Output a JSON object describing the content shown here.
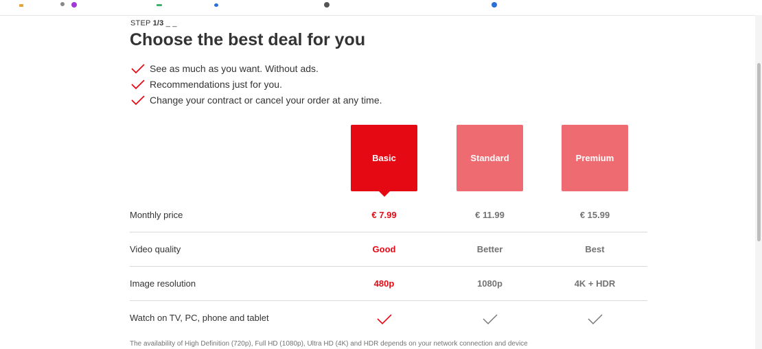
{
  "step": {
    "prefix": "STEP ",
    "current": "1/3",
    "suffix": " _ _"
  },
  "title": "Choose the best deal for you",
  "features": [
    "See as much as you want. Without ads.",
    "Recommendations just for you.",
    "Change your contract or cancel your order at any time."
  ],
  "plans": [
    {
      "name": "Basic",
      "selected": true
    },
    {
      "name": "Standard",
      "selected": false
    },
    {
      "name": "Premium",
      "selected": false
    }
  ],
  "rows": [
    {
      "label": "Monthly price",
      "values": [
        "€ 7.99",
        "€ 11.99",
        "€ 15.99"
      ]
    },
    {
      "label": "Video quality",
      "values": [
        "Good",
        "Better",
        "Best"
      ]
    },
    {
      "label": "Image resolution",
      "values": [
        "480p",
        "1080p",
        "4K + HDR"
      ]
    },
    {
      "label": "Watch on TV, PC, phone and tablet",
      "values": [
        "check-icon",
        "check-icon",
        "check-icon"
      ]
    }
  ],
  "footnote": "The availability of High Definition (720p), Full HD (1080p), Ultra HD (4K) and HDR depends on your network connection and device",
  "colors": {
    "accent": "#e50914",
    "unselected_plan": "#ef6b72",
    "muted_text": "#737373"
  }
}
